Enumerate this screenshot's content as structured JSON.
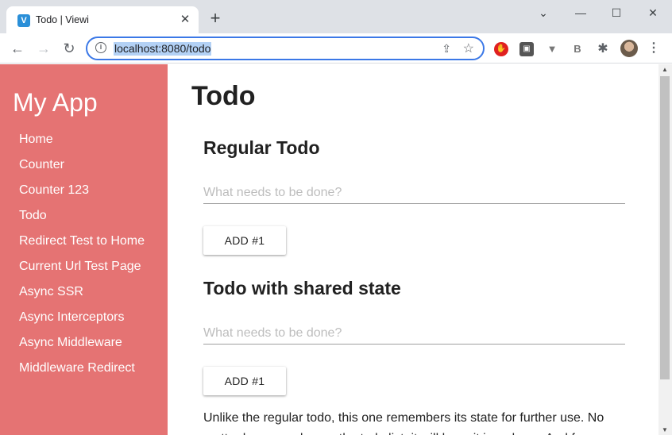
{
  "browser": {
    "tab_title": "Todo | Viewi",
    "favicon_letter": "V",
    "tab_close": "✕",
    "new_tab": "+",
    "window_controls": {
      "dropdown": "⌄",
      "minimize": "—",
      "maximize": "☐",
      "close": "✕"
    },
    "nav": {
      "back": "←",
      "forward": "→",
      "reload": "↻"
    },
    "url": "localhost:8080/todo",
    "info_icon": "i",
    "share_icon": "⇪",
    "star_icon": "☆",
    "extensions": [
      {
        "name": "adblock-extension-icon",
        "glyph": "✋"
      },
      {
        "name": "screenshot-extension-icon",
        "glyph": "▣"
      },
      {
        "name": "vue-devtools-extension-icon",
        "glyph": "▼"
      },
      {
        "name": "bookmark-extension-icon",
        "glyph": "B"
      },
      {
        "name": "puzzle-extensions-icon",
        "glyph": "✱"
      }
    ],
    "menu_icon": "⋮"
  },
  "sidebar": {
    "app_title": "My App",
    "items": [
      "Home",
      "Counter",
      "Counter 123",
      "Todo",
      "Redirect Test to Home",
      "Current Url Test Page",
      "Async SSR",
      "Async Interceptors",
      "Async Middleware",
      "Middleware Redirect"
    ]
  },
  "main": {
    "page_title": "Todo",
    "regular": {
      "title": "Regular Todo",
      "placeholder": "What needs to be done?",
      "add_label": "ADD #1"
    },
    "shared": {
      "title": "Todo with shared state",
      "placeholder": "What needs to be done?",
      "add_label": "ADD #1"
    },
    "description": "Unlike the regular todo, this one remembers its state for further use. No matter how you change the todo list, it will keep it in reducer. And for more"
  },
  "scrollbar": {
    "up": "▲",
    "down": "▼"
  },
  "colors": {
    "sidebar": "#e57373",
    "accent": "#3b78e7"
  }
}
